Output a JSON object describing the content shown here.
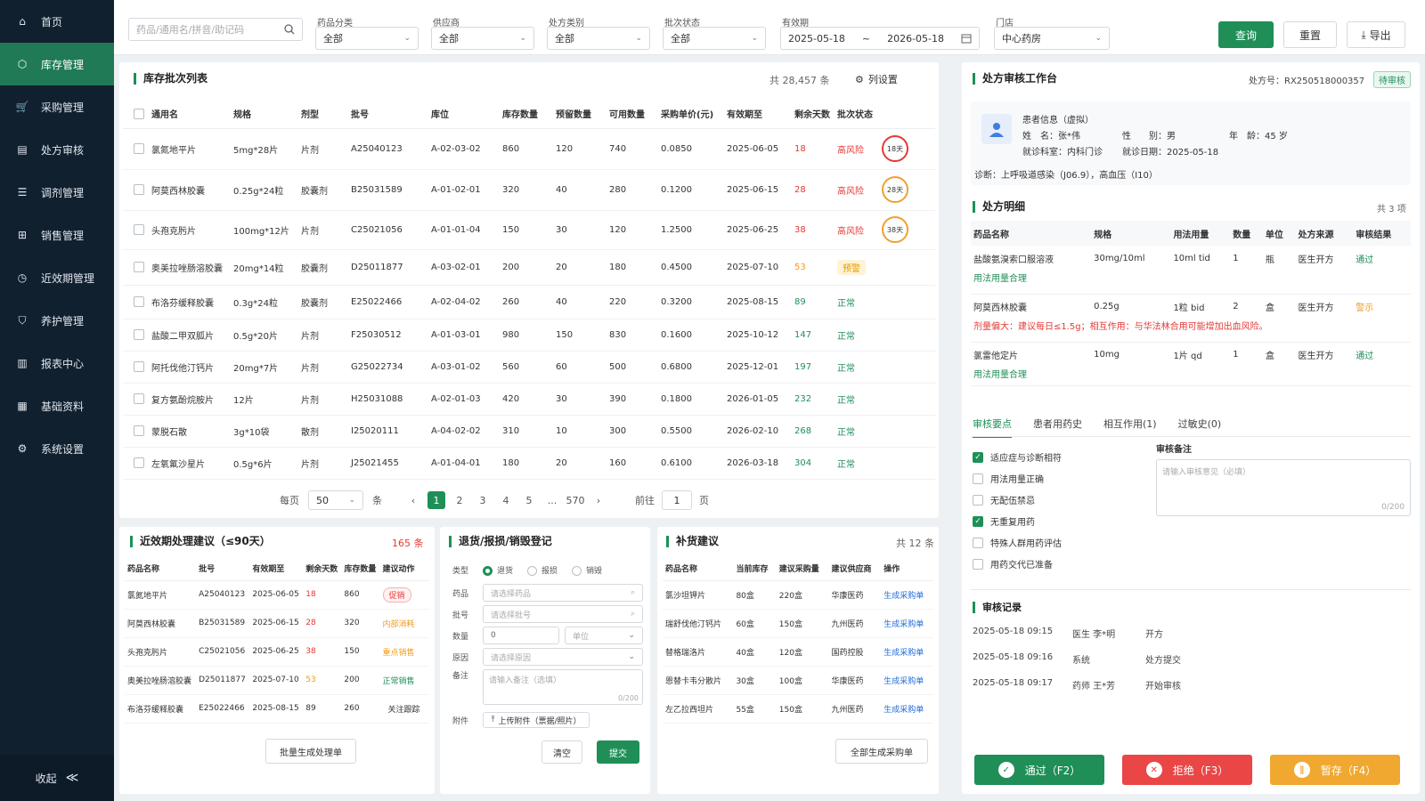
{
  "sidebar": {
    "items": [
      {
        "label": "首页",
        "icon": "home-icon"
      },
      {
        "label": "库存管理",
        "icon": "box-icon"
      },
      {
        "label": "采购管理",
        "icon": "cart-icon"
      },
      {
        "label": "处方审核",
        "icon": "prescription-icon"
      },
      {
        "label": "调剂管理",
        "icon": "list-icon"
      },
      {
        "label": "销售管理",
        "icon": "shopping-cart-icon"
      },
      {
        "label": "近效期管理",
        "icon": "clock-icon"
      },
      {
        "label": "养护管理",
        "icon": "shield-icon"
      },
      {
        "label": "报表中心",
        "icon": "report-icon"
      },
      {
        "label": "基础资料",
        "icon": "grid-icon"
      },
      {
        "label": "系统设置",
        "icon": "gear-icon"
      }
    ],
    "collapse_label": "收起",
    "collapse_icon": "≪"
  },
  "filters": {
    "search_placeholder": "药品/通用名/拼音/助记码",
    "drug_category": {
      "label": "药品分类",
      "value": "全部"
    },
    "supplier": {
      "label": "供应商",
      "value": "全部"
    },
    "rx_type": {
      "label": "处方类别",
      "value": "全部"
    },
    "batch_status": {
      "label": "批次状态",
      "value": "全部"
    },
    "expiry": {
      "label": "有效期",
      "from": "2025-05-18",
      "sep": "~",
      "to": "2026-05-18"
    },
    "store": {
      "label": "门店",
      "value": "中心药房"
    },
    "query_label": "查询",
    "reset_label": "重置",
    "export_label": "导出"
  },
  "inventory": {
    "title": "库存批次列表",
    "total": "共 28,457 条",
    "column_settings": "列设置",
    "columns": [
      "通用名",
      "规格",
      "剂型",
      "批号",
      "库位",
      "库存数量",
      "预留数量",
      "可用数量",
      "采购单价(元)",
      "有效期至",
      "剩余天数",
      "批次状态"
    ],
    "rows": [
      [
        "氯氮地平片",
        "5mg*28片",
        "片剂",
        "A25040123",
        "A-02-03-02",
        "860",
        "120",
        "740",
        "0.0850",
        "2025-06-05",
        "18",
        "高风险",
        "18天"
      ],
      [
        "阿莫西林胶囊",
        "0.25g*24粒",
        "胶囊剂",
        "B25031589",
        "A-01-02-01",
        "320",
        "40",
        "280",
        "0.1200",
        "2025-06-15",
        "28",
        "高风险",
        "28天"
      ],
      [
        "头孢克肟片",
        "100mg*12片",
        "片剂",
        "C25021056",
        "A-01-01-04",
        "150",
        "30",
        "120",
        "1.2500",
        "2025-06-25",
        "38",
        "高风险",
        "38天"
      ],
      [
        "奥美拉唑肠溶胶囊",
        "20mg*14粒",
        "胶囊剂",
        "D25011877",
        "A-03-02-01",
        "200",
        "20",
        "180",
        "0.4500",
        "2025-07-10",
        "53",
        "预警",
        ""
      ],
      [
        "布洛芬缓释胶囊",
        "0.3g*24粒",
        "胶囊剂",
        "E25022466",
        "A-02-04-02",
        "260",
        "40",
        "220",
        "0.3200",
        "2025-08-15",
        "89",
        "正常",
        ""
      ],
      [
        "盐酸二甲双胍片",
        "0.5g*20片",
        "片剂",
        "F25030512",
        "A-01-03-01",
        "980",
        "150",
        "830",
        "0.1600",
        "2025-10-12",
        "147",
        "正常",
        ""
      ],
      [
        "阿托伐他汀钙片",
        "20mg*7片",
        "片剂",
        "G25022734",
        "A-03-01-02",
        "560",
        "60",
        "500",
        "0.6800",
        "2025-12-01",
        "197",
        "正常",
        ""
      ],
      [
        "复方氨酚烷胺片",
        "12片",
        "片剂",
        "H25031088",
        "A-02-01-03",
        "420",
        "30",
        "390",
        "0.1800",
        "2026-01-05",
        "232",
        "正常",
        ""
      ],
      [
        "蒙脱石散",
        "3g*10袋",
        "散剂",
        "I25020111",
        "A-04-02-02",
        "310",
        "10",
        "300",
        "0.5500",
        "2026-02-10",
        "268",
        "正常",
        ""
      ],
      [
        "左氧氟沙星片",
        "0.5g*6片",
        "片剂",
        "J25021455",
        "A-01-04-01",
        "180",
        "20",
        "160",
        "0.6100",
        "2026-03-18",
        "304",
        "正常",
        ""
      ]
    ],
    "pager": {
      "per_page_label": "每页",
      "per_page": "50",
      "unit": "条",
      "pages": [
        "1",
        "2",
        "3",
        "4",
        "5",
        "...",
        "570"
      ],
      "goto_label": "前往",
      "goto_value": "1",
      "page_unit": "页"
    }
  },
  "near_expiry": {
    "title": "近效期处理建议（≤90天）",
    "count": "165 条",
    "columns": [
      "药品名称",
      "批号",
      "有效期至",
      "剩余天数",
      "库存数量",
      "建议动作"
    ],
    "rows": [
      [
        "氯氮地平片",
        "A25040123",
        "2025-06-05",
        "18",
        "860",
        "促销"
      ],
      [
        "阿莫西林胶囊",
        "B25031589",
        "2025-06-15",
        "28",
        "320",
        "内部消耗"
      ],
      [
        "头孢克肟片",
        "C25021056",
        "2025-06-25",
        "38",
        "150",
        "重点销售"
      ],
      [
        "奥美拉唑肠溶胶囊",
        "D25011877",
        "2025-07-10",
        "53",
        "200",
        "正常销售"
      ],
      [
        "布洛芬缓释胶囊",
        "E25022466",
        "2025-08-15",
        "89",
        "260",
        "关注跟踪"
      ]
    ],
    "button": "批量生成处理单"
  },
  "return_form": {
    "title": "退货/报损/销毁登记",
    "type_label": "类型",
    "types": [
      "退货",
      "报损",
      "销毁"
    ],
    "drug_label": "药品",
    "drug_placeholder": "请选择药品",
    "batch_label": "批号",
    "batch_placeholder": "请选择批号",
    "qty_label": "数量",
    "qty_value": "0",
    "unit_placeholder": "单位",
    "reason_label": "原因",
    "reason_placeholder": "请选择原因",
    "note_label": "备注",
    "note_placeholder": "请输入备注（选填）",
    "note_counter": "0/200",
    "attach_label": "附件",
    "attach_button": "上传附件（票据/照片）",
    "clear_label": "清空",
    "submit_label": "提交"
  },
  "restock": {
    "title": "补货建议",
    "count": "共 12 条",
    "columns": [
      "药品名称",
      "当前库存",
      "建议采购量",
      "建议供应商",
      "操作"
    ],
    "rows": [
      [
        "氯沙坦钾片",
        "80盒",
        "220盒",
        "华康医药",
        "生成采购单"
      ],
      [
        "瑞舒伐他汀钙片",
        "60盒",
        "150盒",
        "九州医药",
        "生成采购单"
      ],
      [
        "替格瑞洛片",
        "40盒",
        "120盒",
        "国药控股",
        "生成采购单"
      ],
      [
        "恩替卡韦分散片",
        "30盒",
        "100盒",
        "华康医药",
        "生成采购单"
      ],
      [
        "左乙拉西坦片",
        "55盒",
        "150盒",
        "九州医药",
        "生成采购单"
      ]
    ],
    "button": "全部生成采购单"
  },
  "review": {
    "title": "处方审核工作台",
    "rx_no": "处方号：RX250518000357",
    "status": "待审核",
    "patient_header": "患者信息（虚拟）",
    "name": "姓　名：张*伟",
    "gender": "性　　别：男",
    "age": "年　龄：45 岁",
    "dept": "就诊科室：内科门诊",
    "date": "就诊日期：2025-05-18",
    "diagnosis": "诊断：上呼吸道感染（J06.9），高血压（I10）",
    "detail_title": "处方明细",
    "detail_count": "共 3 项",
    "detail_columns": [
      "药品名称",
      "规格",
      "用法用量",
      "数量",
      "单位",
      "处方来源",
      "审核结果"
    ],
    "detail_rows": [
      {
        "cells": [
          "盐酸氨溴索口服溶液",
          "30mg/10ml",
          "10ml tid",
          "1",
          "瓶",
          "医生开方",
          "通过"
        ],
        "note": "用法用量合理",
        "note_color": "#1f8f57",
        "result_color": "#1f8f57"
      },
      {
        "cells": [
          "阿莫西林胶囊",
          "0.25g",
          "1粒 bid",
          "2",
          "盒",
          "医生开方",
          "警示"
        ],
        "note": "剂量偏大：建议每日≤1.5g；相互作用：与华法林合用可能增加出血风险。",
        "note_color": "#e53935",
        "result_color": "#f29b1c"
      },
      {
        "cells": [
          "氯雷他定片",
          "10mg",
          "1片 qd",
          "1",
          "盒",
          "医生开方",
          "通过"
        ],
        "note": "用法用量合理",
        "note_color": "#1f8f57",
        "result_color": "#1f8f57"
      }
    ],
    "tabs": [
      "审核要点",
      "患者用药史",
      "相互作用(1)",
      "过敏史(0)"
    ],
    "checklist": [
      {
        "label": "适应症与诊断相符",
        "checked": true
      },
      {
        "label": "用法用量正确",
        "checked": false
      },
      {
        "label": "无配伍禁忌",
        "checked": false
      },
      {
        "label": "无重复用药",
        "checked": true
      },
      {
        "label": "特殊人群用药评估",
        "checked": false
      },
      {
        "label": "用药交代已准备",
        "checked": false
      }
    ],
    "remark_label": "审核备注",
    "remark_placeholder": "请输入审核意见（必填）",
    "remark_counter": "0/200",
    "log_title": "审核记录",
    "log": [
      [
        "2025-05-18 09:15",
        "医生 李*明",
        "开方"
      ],
      [
        "2025-05-18 09:16",
        "系统",
        "处方提交"
      ],
      [
        "2025-05-18 09:17",
        "药师 王*芳",
        "开始审核"
      ]
    ],
    "pass_label": "通过（F2）",
    "reject_label": "拒绝（F3）",
    "hold_label": "暂存（F4）"
  },
  "colors": {
    "accent": "#1f8f57",
    "sidebar": "#11202f",
    "danger": "#e53935",
    "warning": "#f29b1c",
    "hold": "#f0a830",
    "link": "#1e6bd6"
  }
}
